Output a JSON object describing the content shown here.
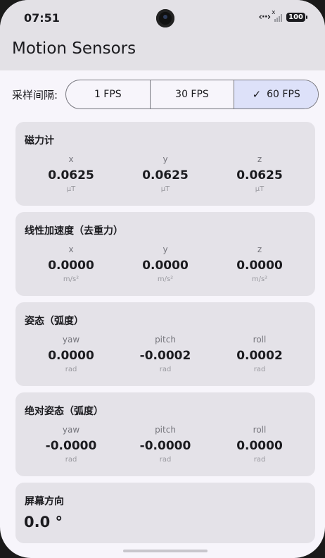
{
  "status_bar": {
    "time": "07:51",
    "data_icon": "‹··›",
    "signal_mark": "x",
    "battery": "100"
  },
  "app": {
    "title": "Motion Sensors"
  },
  "sampling": {
    "label": "采样间隔:",
    "options": [
      "1 FPS",
      "30 FPS",
      "60 FPS"
    ],
    "selected": "60 FPS",
    "check_icon": "✓"
  },
  "cards": {
    "magnetometer": {
      "title": "磁力计",
      "axes": [
        {
          "name": "x",
          "value": "0.0625",
          "unit": "μT"
        },
        {
          "name": "y",
          "value": "0.0625",
          "unit": "μT"
        },
        {
          "name": "z",
          "value": "0.0625",
          "unit": "μT"
        }
      ]
    },
    "linear_acceleration": {
      "title": "线性加速度（去重力）",
      "axes": [
        {
          "name": "x",
          "value": "0.0000",
          "unit": "m/s²"
        },
        {
          "name": "y",
          "value": "0.0000",
          "unit": "m/s²"
        },
        {
          "name": "z",
          "value": "0.0000",
          "unit": "m/s²"
        }
      ]
    },
    "attitude": {
      "title": "姿态（弧度）",
      "axes": [
        {
          "name": "yaw",
          "value": "0.0000",
          "unit": "rad"
        },
        {
          "name": "pitch",
          "value": "-0.0002",
          "unit": "rad"
        },
        {
          "name": "roll",
          "value": "0.0002",
          "unit": "rad"
        }
      ]
    },
    "absolute_attitude": {
      "title": "绝对姿态（弧度）",
      "axes": [
        {
          "name": "yaw",
          "value": "-0.0000",
          "unit": "rad"
        },
        {
          "name": "pitch",
          "value": "-0.0000",
          "unit": "rad"
        },
        {
          "name": "roll",
          "value": "0.0000",
          "unit": "rad"
        }
      ]
    },
    "screen_orientation": {
      "title": "屏幕方向",
      "value": "0.0 °"
    }
  },
  "colors": {
    "header_bg": "#e3e1e6",
    "page_bg": "#f7f5fb",
    "card_bg": "#e4e2e8",
    "selected_segment": "#dde1f9",
    "text_primary": "#1b1b1f",
    "text_secondary": "#75757c"
  }
}
